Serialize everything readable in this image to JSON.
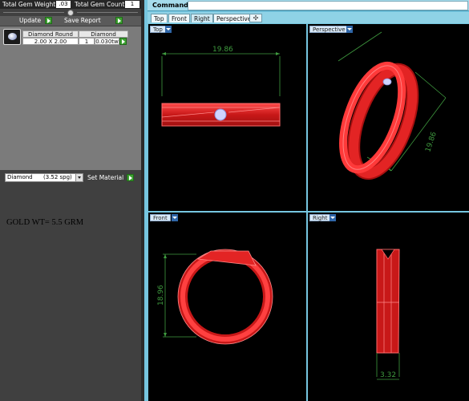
{
  "gem_summary": {
    "weight_label": "Total Gem Weight",
    "weight_value": ".03",
    "count_label": "Total Gem Count",
    "count_value": "1"
  },
  "toolbar": {
    "update_label": "Update",
    "save_report_label": "Save Report"
  },
  "gem_list": {
    "headers": [
      "Diamond Round",
      "Diamond"
    ],
    "row": {
      "size": "2.00 X 2.00",
      "count": "1",
      "weight": "0.030tw"
    }
  },
  "material": {
    "selected": "Diamond      (3.52 spg)",
    "set_label": "Set Material"
  },
  "note": "GOLD WT= 5.5 GRM",
  "command": {
    "label": "Command:"
  },
  "tabs": [
    {
      "label": "Top"
    },
    {
      "label": "Front"
    },
    {
      "label": "Right"
    },
    {
      "label": "Perspective"
    }
  ],
  "viewports": {
    "top": {
      "label": "Top",
      "dimension": "19.86"
    },
    "perspective": {
      "label": "Perspective",
      "dimension": "19.86"
    },
    "front": {
      "label": "Front",
      "dimension": "18.96"
    },
    "right": {
      "label": "Right",
      "dimension": "3.32"
    }
  },
  "colors": {
    "ring": "#e32424",
    "dimension": "#3f9b3f",
    "viewport_bg": "#000000",
    "tab_bar": "#8fd2e6"
  }
}
